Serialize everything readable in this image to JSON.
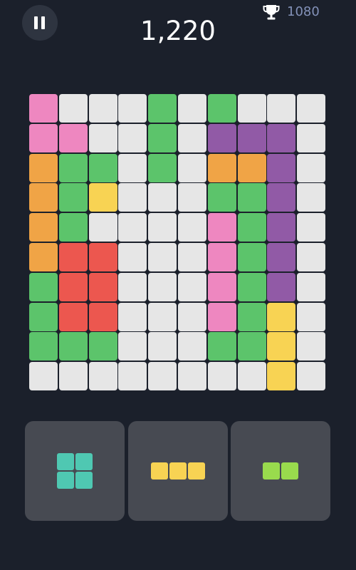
{
  "header": {
    "pause_icon": "pause-icon",
    "score": "1,220",
    "best_score_icon": "trophy-icon",
    "best_score": "1080"
  },
  "colors": {
    "background": "#1b202b",
    "empty": "#e6e6e6",
    "pink": "#ee87c0",
    "green": "#5cc46b",
    "purple": "#915aa6",
    "orange": "#f0a446",
    "yellow": "#f8d353",
    "red": "#ec574f",
    "teal": "#4fc8b2",
    "lime": "#99db4d",
    "tray_bg": "#474a52",
    "best_score_text": "#8391b8"
  },
  "board": {
    "size": 10,
    "rows": [
      [
        "pink",
        "empty",
        "empty",
        "empty",
        "green",
        "empty",
        "green",
        "empty",
        "empty",
        "empty"
      ],
      [
        "pink",
        "pink",
        "empty",
        "empty",
        "green",
        "empty",
        "purple",
        "purple",
        "purple",
        "empty"
      ],
      [
        "orange",
        "green",
        "green",
        "empty",
        "green",
        "empty",
        "orange",
        "orange",
        "purple",
        "empty"
      ],
      [
        "orange",
        "green",
        "yellow",
        "empty",
        "empty",
        "empty",
        "green",
        "green",
        "purple",
        "empty"
      ],
      [
        "orange",
        "green",
        "empty",
        "empty",
        "empty",
        "empty",
        "pink",
        "green",
        "purple",
        "empty"
      ],
      [
        "orange",
        "red",
        "red",
        "empty",
        "empty",
        "empty",
        "pink",
        "green",
        "purple",
        "empty"
      ],
      [
        "green",
        "red",
        "red",
        "empty",
        "empty",
        "empty",
        "pink",
        "green",
        "purple",
        "empty"
      ],
      [
        "green",
        "red",
        "red",
        "empty",
        "empty",
        "empty",
        "pink",
        "green",
        "yellow",
        "empty"
      ],
      [
        "green",
        "green",
        "green",
        "empty",
        "empty",
        "empty",
        "green",
        "green",
        "yellow",
        "empty"
      ],
      [
        "empty",
        "empty",
        "empty",
        "empty",
        "empty",
        "empty",
        "empty",
        "empty",
        "yellow",
        "empty"
      ]
    ]
  },
  "tray": [
    {
      "shape": [
        [
          1,
          1
        ],
        [
          1,
          1
        ]
      ],
      "color": "teal"
    },
    {
      "shape": [
        [
          1,
          1,
          1
        ]
      ],
      "color": "yellow"
    },
    {
      "shape": [
        [
          1,
          1
        ]
      ],
      "color": "lime"
    }
  ]
}
